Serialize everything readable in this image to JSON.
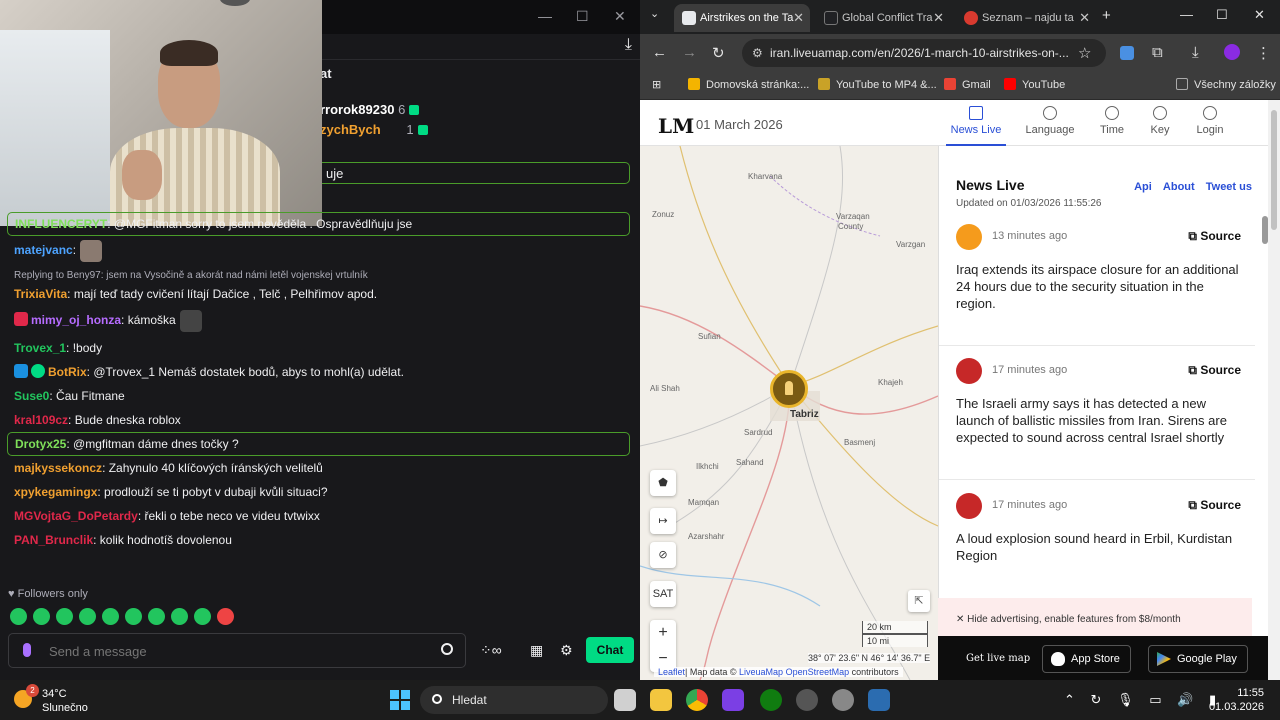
{
  "chat": {
    "heading": "at",
    "gifters": [
      {
        "name": "rrorok89230",
        "count": "6",
        "color": "#ffffff"
      },
      {
        "name": "zychBych",
        "count": "1",
        "color": "#f0a030"
      }
    ],
    "pinned_clip": "uje",
    "messages": [
      {
        "user": "INFLUENCERYT",
        "color": "#7fe05a",
        "text": ": @MGFitman sorry to jsem nevěděla . Ospravědlňuju jse",
        "highlight": true
      },
      {
        "user": "matejvanc",
        "color": "#4da3ff",
        "text": ":",
        "emote": true
      },
      {
        "reply": "Replying to Beny97: jsem na Vysočině a akorát nad námi letěl vojenskej vrtulník",
        "user": "TrixiaVita",
        "color": "#f0a030",
        "text": ": mají teď tady cvičení lítají Dačice , Telč , Pelhřimov apod."
      },
      {
        "user": "mimy_oj_honza",
        "color": "#b66cff",
        "text": ": kámoška",
        "emote": true,
        "badge": "#e0284a"
      },
      {
        "user": "Trovex_1",
        "color": "#22c55e",
        "text": ": !body"
      },
      {
        "user": "BotRix",
        "color": "#f0a030",
        "text": ": @Trovex_1 Nemáš dostatek bodů, abys to mohl(a) udělat.",
        "badge": "#1a90e0",
        "badge2": "#00db84"
      },
      {
        "user": "Suse0",
        "color": "#22c55e",
        "text": ": Čau Fitmane"
      },
      {
        "user": "kral109cz",
        "color": "#e0284a",
        "text": ": Bude dneska roblox"
      },
      {
        "user": "Drotyx25",
        "color": "#7fe05a",
        "text": ": @mgfitman dáme dnes točky ?",
        "highlight": true
      },
      {
        "user": "majkyssekoncz",
        "color": "#f0a030",
        "text": ": Zahynulo 40 klíčových íránských velitelů"
      },
      {
        "user": "xpykegamingx",
        "color": "#f0a030",
        "text": ": prodlouží se ti pobyt v dubaji kvůli situaci?"
      },
      {
        "user": "MGVojtaG_DoPetardy",
        "color": "#e0284a",
        "text": ": řekli o tebe neco ve videu tvtwixx"
      },
      {
        "user": "PAN_Brunclik",
        "color": "#e0284a",
        "text": ": kolik hodnotíš dovolenou"
      }
    ],
    "followers_only": "Followers only",
    "input_placeholder": "Send a message",
    "send_label": "Chat",
    "accent": "#00db84"
  },
  "browser": {
    "tabs": [
      {
        "title": "Airstrikes on the Ta",
        "active": true,
        "fav": "#e8eaed"
      },
      {
        "title": "Global Conflict Tra",
        "active": false,
        "fav": "#202124"
      },
      {
        "title": "Seznam – najdu ta",
        "active": false,
        "fav": "#d83a2f"
      }
    ],
    "url": "iran.liveuamap.com/en/2026/1-march-10-airstrikes-on-...",
    "bookmarks": [
      {
        "label": "Domovská stránka:...",
        "color": "#f4b400"
      },
      {
        "label": "YouTube to MP4 &...",
        "color": "#c9a227"
      },
      {
        "label": "Gmail",
        "color": "#ea4335"
      },
      {
        "label": "YouTube",
        "color": "#ff0000"
      },
      {
        "label": "Všechny záložky",
        "color": "#aaaaaa"
      }
    ]
  },
  "site": {
    "logo": "LM",
    "date": "01 March 2026",
    "nav": [
      "News Live",
      "Language",
      "Time",
      "Key",
      "Login"
    ],
    "accent": "#2a4fd6",
    "feed_title": "News Live",
    "feed_links": [
      "Api",
      "About",
      "Tweet us"
    ],
    "updated": "Updated on 01/03/2026 11:55:26",
    "items": [
      {
        "ago": "13 minutes ago",
        "source": "Source",
        "text": "Iraq extends its airspace closure for an additional 24 hours due to the security situation in the region.",
        "icon_color": "#f59b1c"
      },
      {
        "ago": "17 minutes ago",
        "source": "Source",
        "text": "The Israeli army says it has detected a new launch of ballistic missiles from Iran. Sirens are expected to sound across central Israel shortly",
        "icon_color": "#c62828"
      },
      {
        "ago": "17 minutes ago",
        "source": "Source",
        "text": "A loud explosion sound heard in Erbil, Kurdistan Region",
        "icon_color": "#c62828"
      }
    ],
    "advert": "Hide advertising, enable features from $8/month",
    "app_get": "Get live map",
    "app_store": "App Store",
    "google_play": "Google Play"
  },
  "map": {
    "places": [
      {
        "name": "Kharvana"
      },
      {
        "name": "Zonuz"
      },
      {
        "name": "Varzaqan"
      },
      {
        "name": "County"
      },
      {
        "name": "Varzgan"
      },
      {
        "name": "Sufian"
      },
      {
        "name": "Ali Shah"
      },
      {
        "name": "Khajeh"
      },
      {
        "name": "Tabriz",
        "city": true
      },
      {
        "name": "Basmenj"
      },
      {
        "name": "Sardrud"
      },
      {
        "name": "Ilkhchi"
      },
      {
        "name": "Sahand"
      },
      {
        "name": "Mamqan"
      },
      {
        "name": "Azarshahr"
      }
    ],
    "marker_color": "#e9b52b",
    "sat_label": "SAT",
    "scale_km": "20 km",
    "scale_mi": "10 mi",
    "coords": "38° 07' 23.6\" N 46° 14' 36.7\" E",
    "attrib_leaflet": "Leaflet",
    "attrib_text": "| Map data © ",
    "attrib_liveua": "LiveuaMap",
    "attrib_osm": "OpenStreetMap",
    "attrib_tail": " contributors"
  },
  "taskbar": {
    "weather_temp": "34°C",
    "weather_desc": "Slunečno",
    "weather_badge": "2",
    "search": "Hledat",
    "time": "11:55",
    "date": "01.03.2026"
  }
}
